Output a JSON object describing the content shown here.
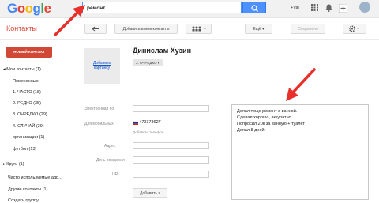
{
  "header": {
    "logo": "Google",
    "search_value": "ремонт",
    "user_link": "+Vai"
  },
  "toolbar": {
    "title": "Контакты",
    "add_to_contacts": "Добавить в мои контакты",
    "more": "Ещё",
    "save": "Сохранено"
  },
  "sidebar": {
    "new_contact": "НОВЫЙ КОНТАКТ",
    "items": [
      "◂ Мои контакты (1)",
      "Помеченные",
      "1. ЧАСТО (18)",
      "2. РЕДКО (35)",
      "3. ОЧРЕДКО (29)",
      "4. СЛУЧАЙ (29)",
      "организации (1)",
      "футбол (13)",
      "▸ Круги (1)",
      "Часто используемые адр...",
      "Другие контакты (1)",
      "Создать группу..."
    ]
  },
  "contact": {
    "name": "Динислам Хузин",
    "group": "3. ОЧРЕДКО",
    "photo_link": "Добавить картинку",
    "labels": {
      "email": "Электронная по",
      "mobile": "Для мобильных",
      "address": "Адрес",
      "birthday": "День рождения",
      "url": "URL"
    },
    "phone": "+79373627",
    "add_phone": "Добавить телефон",
    "add_field": "Добавить ▾"
  },
  "notes": [
    "Делал теще ремонт в ванной.",
    "Сделал хорошо, аккуратно",
    "Попросил 20к за ванную + туалет",
    "Делал 8 дней"
  ],
  "colors": {
    "accent_red": "#dd4b39",
    "button_red": "#d14836",
    "search_blue": "#4d90fe",
    "arrow_red": "#e8302a"
  }
}
